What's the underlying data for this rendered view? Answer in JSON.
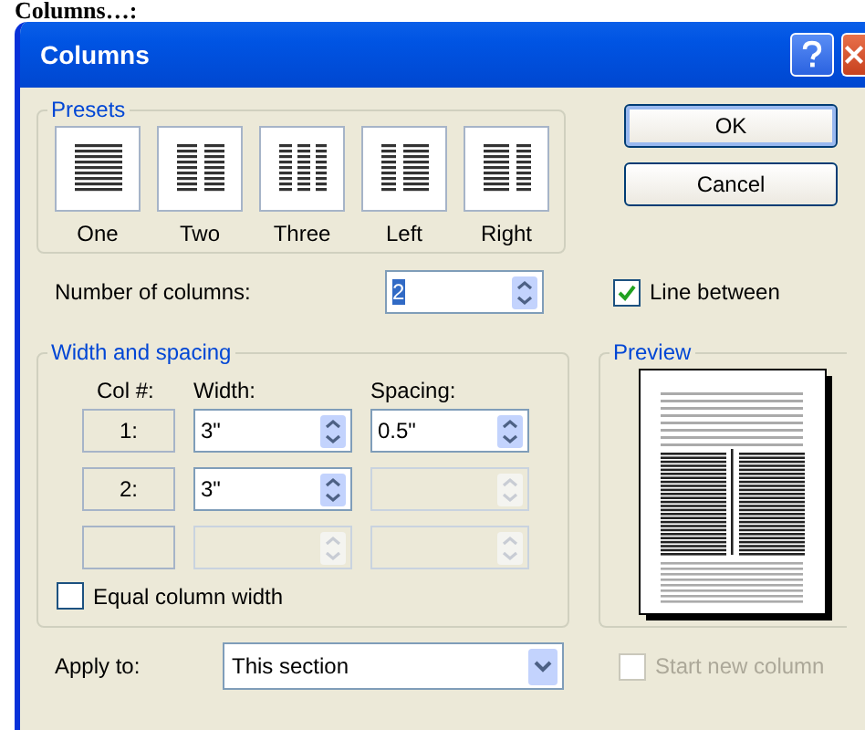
{
  "heading": "Columns…:",
  "window": {
    "title": "Columns"
  },
  "presets": {
    "label": "Presets",
    "items": [
      {
        "label": "One",
        "kind": "one"
      },
      {
        "label": "Two",
        "kind": "two"
      },
      {
        "label": "Three",
        "kind": "three"
      },
      {
        "label": "Left",
        "kind": "left"
      },
      {
        "label": "Right",
        "kind": "right"
      }
    ]
  },
  "buttons": [
    {
      "label": "OK",
      "default": true
    },
    {
      "label": "Cancel",
      "default": false
    }
  ],
  "number_of_columns": {
    "label": "Number of columns:",
    "value": "2"
  },
  "line_between": {
    "label": "Line between",
    "checked": true
  },
  "width_and_spacing": {
    "label": "Width and spacing",
    "headers": [
      "Col #:",
      "Width:",
      "Spacing:"
    ],
    "rows": [
      {
        "col": "1:",
        "width": {
          "value": "3\"",
          "disabled": false
        },
        "spacing": {
          "value": "0.5\"",
          "disabled": false
        }
      },
      {
        "col": "2:",
        "width": {
          "value": "3\"",
          "disabled": false
        },
        "spacing": {
          "disabled": true
        }
      },
      {
        "width": {
          "disabled": true
        },
        "spacing": {
          "disabled": true
        }
      }
    ]
  },
  "equal_column_width": {
    "label": "Equal column width",
    "checked": false
  },
  "preview": {
    "label": "Preview"
  },
  "apply_to": {
    "label": "Apply to:",
    "value": "This section"
  },
  "start_new_column": {
    "label": "Start new column",
    "checked": false,
    "disabled": true
  }
}
